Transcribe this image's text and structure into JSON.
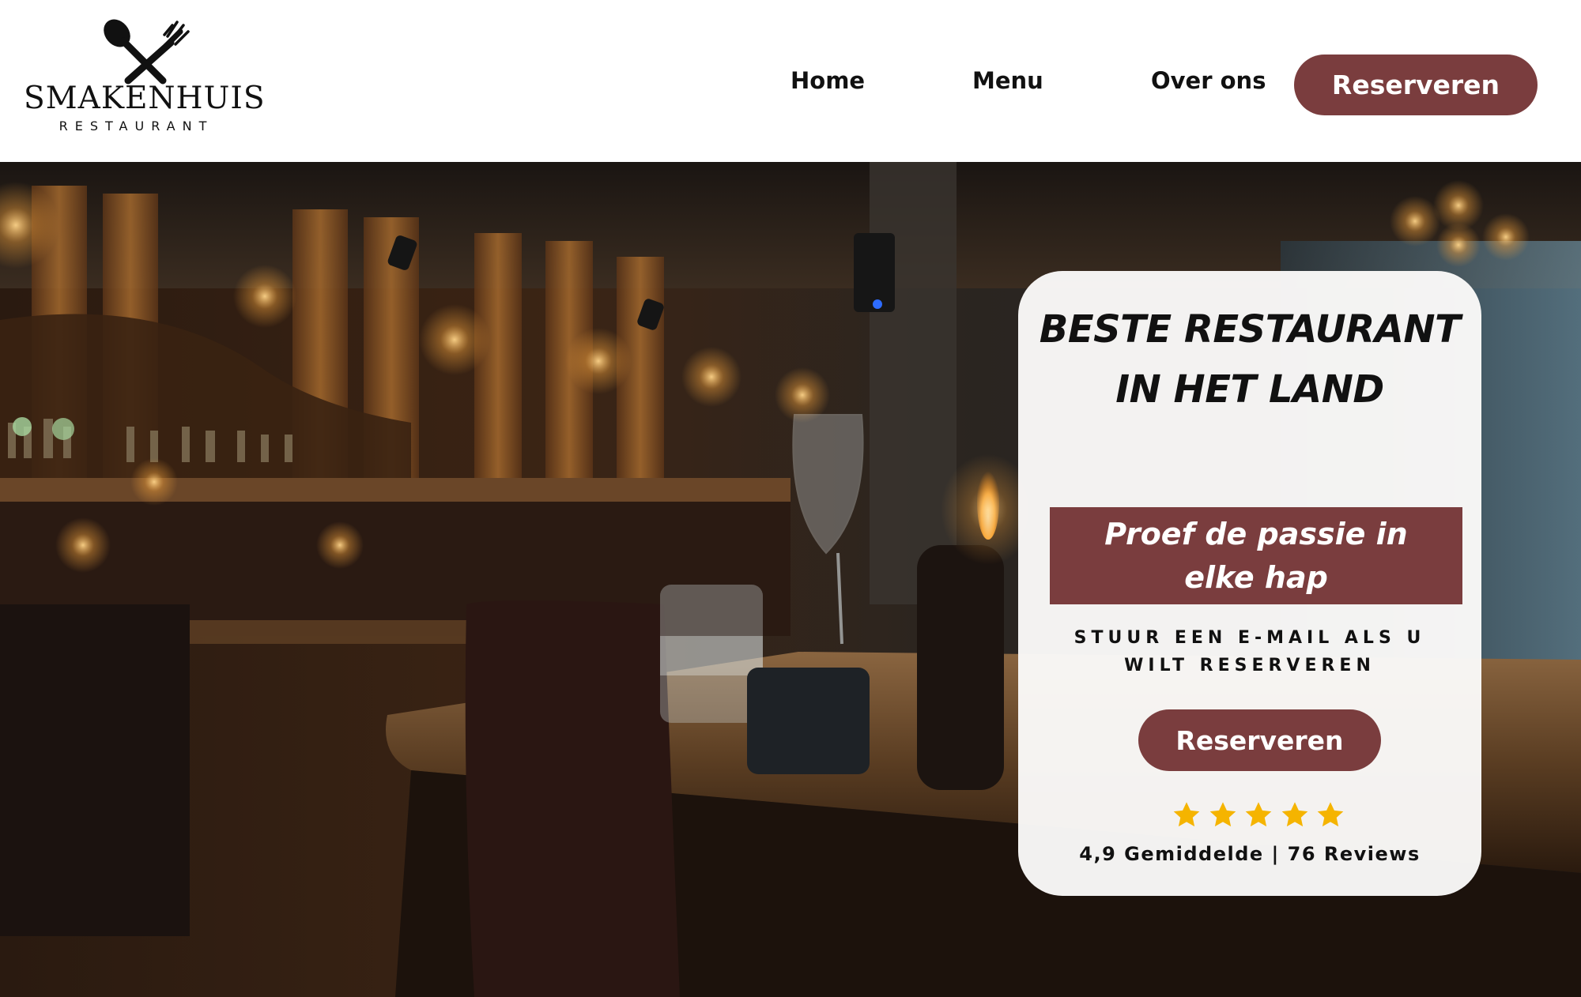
{
  "brand": {
    "name": "SMAKENHUIS",
    "subtitle": "RESTAURANT",
    "icon": "spoon-fork-icon"
  },
  "nav": {
    "items": [
      {
        "label": "Home"
      },
      {
        "label": "Menu"
      },
      {
        "label": "Over ons"
      }
    ],
    "cta_label": "Reserveren"
  },
  "hero": {
    "image": "restaurant-interior-photo",
    "card": {
      "title": "BESTE RESTAURANT IN HET LAND",
      "tagline": "Proef de passie in elke hap",
      "instruction": "STUUR EEN E-MAIL ALS U WILT RESERVEREN",
      "cta_label": "Reserveren",
      "rating": {
        "stars": 5,
        "text": "4,9 Gemiddelde | 76 Reviews"
      }
    }
  },
  "colors": {
    "accent": "#7a3d3e",
    "star": "#f5b400",
    "text": "#111111",
    "background": "#ffffff"
  }
}
